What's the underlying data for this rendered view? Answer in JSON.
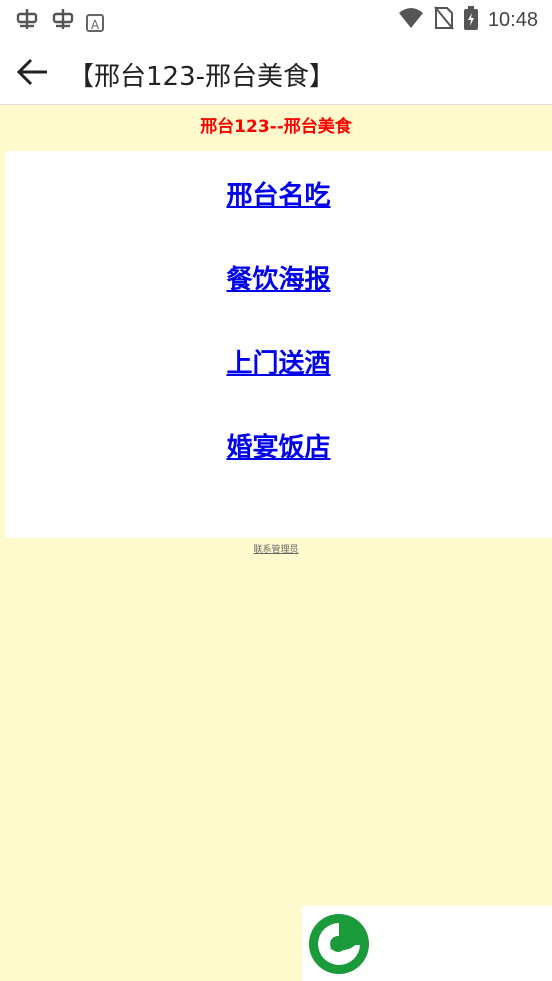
{
  "status_bar": {
    "time": "10:48",
    "left_icons": [
      "bug-icon",
      "bug-icon",
      "a-icon"
    ],
    "right_icons": [
      "wifi-icon",
      "no-sim-icon",
      "battery-charging-icon"
    ]
  },
  "title_bar": {
    "title": "【邢台123-邢台美食】"
  },
  "page": {
    "header": "邢台123--邢台美食",
    "links": [
      "邢台名吃",
      "餐饮海报",
      "上门送酒",
      "婚宴饭店"
    ],
    "admin_link": "联系管理员"
  },
  "colors": {
    "background": "#fffacd",
    "header_red": "#ff0000",
    "link_blue": "#0000ee",
    "logo_green": "#1a9a3a"
  }
}
